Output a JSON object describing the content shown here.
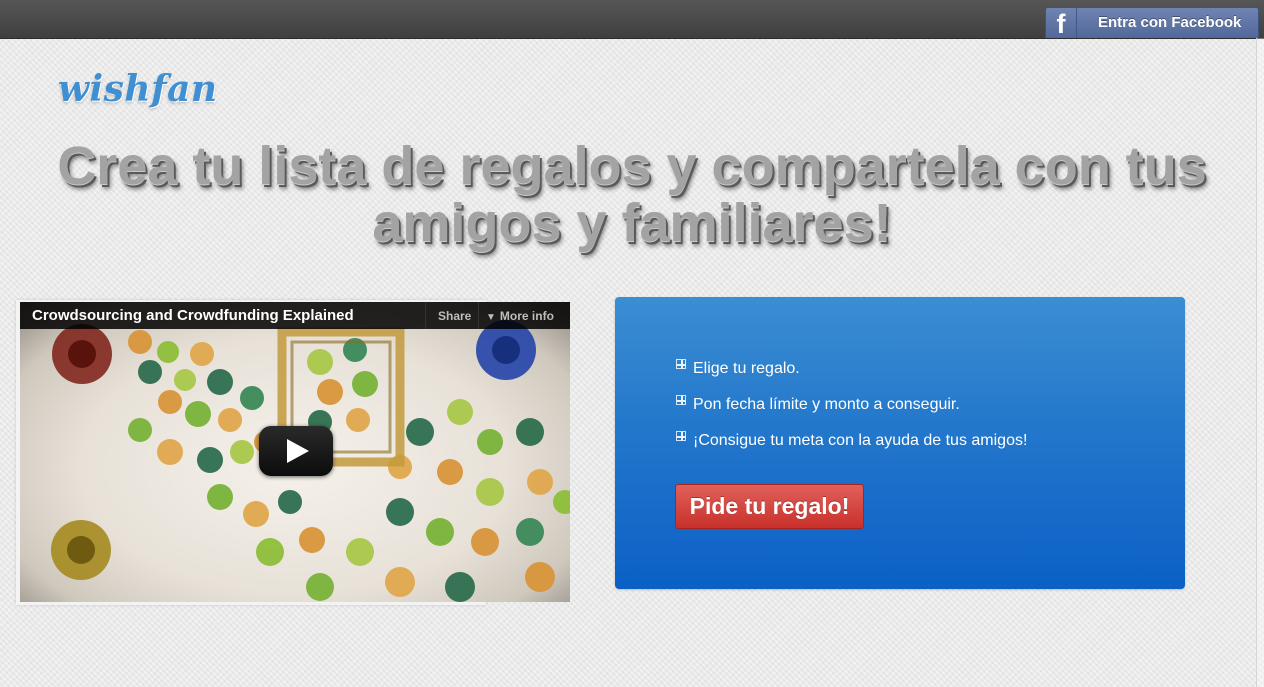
{
  "topbar": {
    "facebook_button": {
      "icon": "facebook-icon",
      "icon_glyph": "f",
      "label": "Entra con Facebook"
    }
  },
  "logo": {
    "text": "wishfan"
  },
  "headline": {
    "line1": "Crea tu lista de regalos y compartela con tus",
    "line2": "amigos y familiares!"
  },
  "video": {
    "title": "Crowdsourcing and Crowdfunding Explained",
    "share_label": "Share",
    "more_info_label": "More info",
    "play_icon": "play-icon"
  },
  "panel": {
    "steps": [
      {
        "icon": "gift-icon",
        "text": "Elige tu regalo."
      },
      {
        "icon": "gift-icon",
        "text": "Pon fecha límite y monto a conseguir."
      },
      {
        "icon": "gift-icon",
        "text": "¡Consigue tu meta con la ayuda de tus amigos!"
      }
    ],
    "cta_label": "Pide tu regalo!"
  },
  "colors": {
    "topbar": "#4a4a4a",
    "facebook": "#5f75a6",
    "logo": "#3f8fd2",
    "panel": "#2377cb",
    "cta": "#d3403b"
  }
}
